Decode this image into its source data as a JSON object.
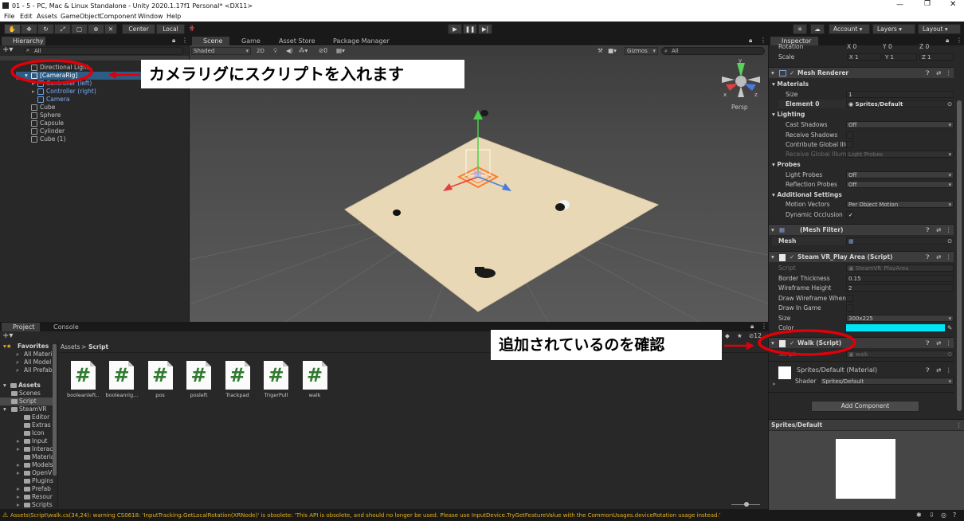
{
  "window": {
    "title": "01 - 5 - PC, Mac & Linux Standalone - Unity 2020.1.17f1 Personal* <DX11>"
  },
  "menu": [
    "File",
    "Edit",
    "Assets",
    "GameObject",
    "Component",
    "Window",
    "Help"
  ],
  "toolbar": {
    "center": "Center",
    "local": "Local",
    "account": "Account",
    "layers": "Layers",
    "layout": "Layout"
  },
  "hierarchy": {
    "tab": "Hierarchy",
    "search_placeholder": "All",
    "items": [
      "Directional Light",
      "[CameraRig]",
      "Controller (left)",
      "Controller (right)",
      "Camera",
      "Cube",
      "Sphere",
      "Capsule",
      "Cylinder",
      "Cube (1)"
    ]
  },
  "scene": {
    "tabs": [
      "Scene",
      "Game",
      "Asset Store",
      "Package Manager"
    ],
    "shading": "Shaded",
    "mode2d": "2D",
    "gizmos": "Gizmos",
    "search_placeholder": "All",
    "visibility_count": "0",
    "persp": "Persp",
    "axis_labels": [
      "y",
      "x",
      "z"
    ]
  },
  "project": {
    "tabs": [
      "Project",
      "Console"
    ],
    "favorites_label": "Favorites",
    "favorites": [
      "All Materi",
      "All Model",
      "All Prefab"
    ],
    "assets_label": "Assets",
    "folders": [
      {
        "name": "Scenes",
        "indent": 1
      },
      {
        "name": "Script",
        "indent": 1
      },
      {
        "name": "SteamVR",
        "indent": 1
      },
      {
        "name": "Editor",
        "indent": 2
      },
      {
        "name": "Extras",
        "indent": 2
      },
      {
        "name": "Icon",
        "indent": 2
      },
      {
        "name": "Input",
        "indent": 2
      },
      {
        "name": "Interac",
        "indent": 2
      },
      {
        "name": "Materia",
        "indent": 2
      },
      {
        "name": "Models",
        "indent": 2
      },
      {
        "name": "OpenV",
        "indent": 2
      },
      {
        "name": "Plugins",
        "indent": 2
      },
      {
        "name": "Prefab",
        "indent": 2
      },
      {
        "name": "Resour",
        "indent": 2
      },
      {
        "name": "Scripts",
        "indent": 2
      }
    ],
    "breadcrumb": [
      "Assets",
      "Script"
    ],
    "hidden_count": "12",
    "assets": [
      "booleanleft...",
      "booleanrig...",
      "pos",
      "posleft",
      "Trackpad",
      "TrigerPull",
      "walk"
    ]
  },
  "inspector": {
    "tab": "Inspector",
    "transform": {
      "rotation_label": "Rotation",
      "scale_label": "Scale",
      "rotation": [
        "X 0",
        "Y 0",
        "Z 0"
      ],
      "scale": [
        "X 1",
        "Y 1",
        "Z 1"
      ]
    },
    "mesh_renderer": {
      "title": "Mesh Renderer",
      "materials_label": "Materials",
      "size_label": "Size",
      "size": "1",
      "element_label": "Element 0",
      "element": "Sprites/Default",
      "lighting_label": "Lighting",
      "cast_shadows_label": "Cast Shadows",
      "cast_shadows": "Off",
      "receive_shadows_label": "Receive Shadows",
      "contribute_gi_label": "Contribute Global Illu",
      "receive_gi_label": "Receive Global Illumi",
      "receive_gi": "Light Probes",
      "probes_label": "Probes",
      "light_probes_label": "Light Probes",
      "light_probes": "Off",
      "reflection_probes_label": "Reflection Probes",
      "reflection_probes": "Off",
      "additional_label": "Additional Settings",
      "motion_vectors_label": "Motion Vectors",
      "motion_vectors": "Per Object Motion",
      "dynamic_occlusion_label": "Dynamic Occlusion",
      "dynamic_occlusion_check": "✓"
    },
    "mesh_filter": {
      "title": "(Mesh Filter)",
      "mesh_label": "Mesh"
    },
    "steamvr": {
      "title": "Steam VR_Play Area (Script)",
      "script_label": "Script",
      "script": "SteamVR_PlayArea",
      "border_label": "Border Thickness",
      "border": "0.15",
      "wire_height_label": "Wireframe Height",
      "wire_height": "2",
      "draw_wire_label": "Draw Wireframe When S",
      "draw_game_label": "Draw In Game",
      "size_label": "Size",
      "size": "300x225",
      "color_label": "Color",
      "color": "#00e5f5"
    },
    "walk": {
      "title": "Walk (Script)",
      "script_label": "Script",
      "script": "walk"
    },
    "material": {
      "title": "Sprites/Default (Material)",
      "shader_label": "Shader",
      "shader": "Sprites/Default"
    },
    "add_component": "Add Component",
    "preview_title": "Sprites/Default"
  },
  "annotations": {
    "rig": "カメラリグにスクリプトを入れます",
    "confirm": "追加されているのを確認"
  },
  "status": {
    "message": "Assets\\Script\\walk.cs(34,24): warning CS0618: 'InputTracking.GetLocalRotation(XRNode)' is obsolete: 'This API is obsolete, and should no longer be used. Please use InputDevice.TryGetFeatureValue with the CommonUsages.deviceRotation usage instead.'"
  },
  "colors": {
    "highlight": "#e0000a",
    "selection": "#2c5d87",
    "warning": "#e4b21c",
    "accent_cyan": "#00e5f5"
  }
}
